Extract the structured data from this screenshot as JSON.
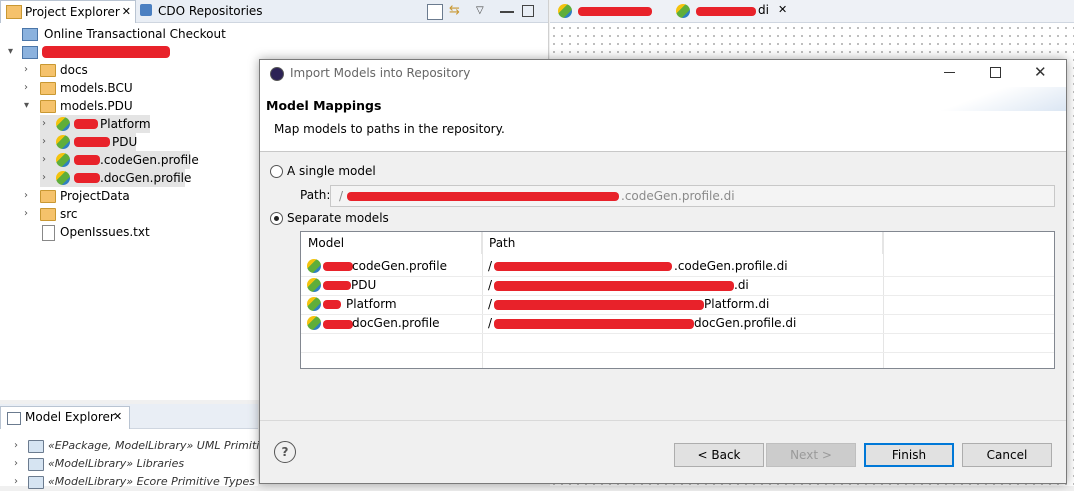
{
  "project_explorer": {
    "tabs": [
      {
        "label": "Project Explorer"
      },
      {
        "label": "CDO Repositories"
      }
    ],
    "tree": [
      {
        "label": "Online Transactional Checkout"
      },
      {
        "label": ""
      },
      {
        "label": "docs"
      },
      {
        "label": "models.BCU"
      },
      {
        "label": "models.PDU"
      },
      {
        "label": "Platform"
      },
      {
        "label": "PDU"
      },
      {
        "label": ".codeGen.profile"
      },
      {
        "label": ".docGen.profile"
      },
      {
        "label": "ProjectData"
      },
      {
        "label": "src"
      },
      {
        "label": "OpenIssues.txt"
      }
    ]
  },
  "editor": {
    "tabs": [
      {
        "label": ""
      },
      {
        "label": "di"
      }
    ]
  },
  "model_explorer": {
    "title": "Model Explorer",
    "items": [
      {
        "label": "«EPackage, ModelLibrary» UML Primitive"
      },
      {
        "label": "«ModelLibrary» Libraries"
      },
      {
        "label": "«ModelLibrary» Ecore Primitive Types"
      }
    ]
  },
  "dialog": {
    "title": "Import Models into Repository",
    "heading": "Model Mappings",
    "description": "Map models to paths in the repository.",
    "single_model_label": "A single model",
    "path_label": "Path:",
    "path_value": "/",
    "path_value_suffix": ".codeGen.profile.di",
    "separate_models_label": "Separate models",
    "table": {
      "columns": [
        "Model",
        "Path"
      ],
      "rows": [
        {
          "model": "codeGen.profile",
          "path_prefix": "/",
          "path_suffix": ".codeGen.profile.di"
        },
        {
          "model": "PDU",
          "path_prefix": "/",
          "path_suffix": ".di"
        },
        {
          "model": "Platform",
          "path_prefix": "/",
          "path_suffix": "Platform.di"
        },
        {
          "model": "docGen.profile",
          "path_prefix": "/",
          "path_suffix": "docGen.profile.di"
        }
      ]
    },
    "buttons": {
      "help": "?",
      "back": "< Back",
      "next": "Next >",
      "finish": "Finish",
      "cancel": "Cancel"
    },
    "selected_option": "separate"
  }
}
